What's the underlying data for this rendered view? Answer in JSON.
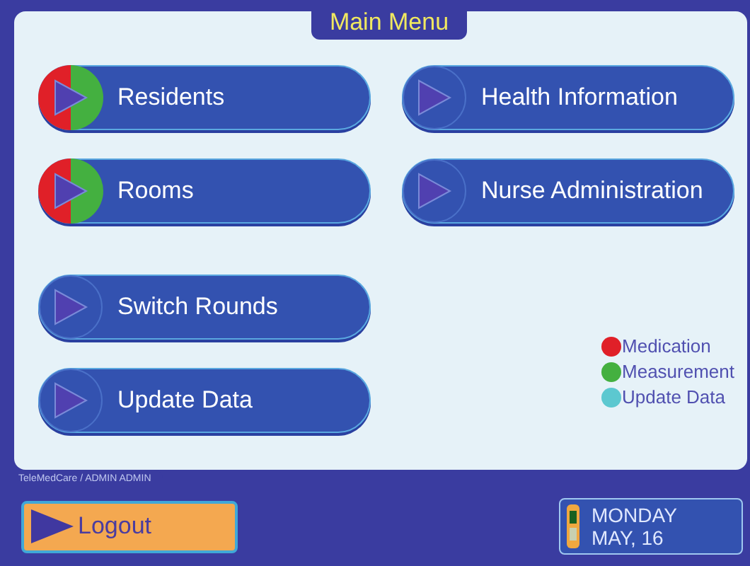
{
  "title": "Main Menu",
  "left_menu": [
    {
      "label": "Residents",
      "markers": [
        {
          "color": "#e02028"
        },
        {
          "color": "#44b040"
        }
      ]
    },
    {
      "label": "Rooms",
      "markers": [
        {
          "color": "#e02028"
        },
        {
          "color": "#44b040"
        }
      ]
    },
    {
      "label": "Switch Rounds"
    },
    {
      "label": "Update Data"
    }
  ],
  "right_menu": [
    {
      "label": "Health Information"
    },
    {
      "label": "Nurse Administration"
    }
  ],
  "legend": [
    {
      "label": "Medication",
      "color": "#e02028"
    },
    {
      "label": "Measurement",
      "color": "#44b040"
    },
    {
      "label": "Update Data",
      "color": "#5cc8d0"
    }
  ],
  "user_tab": "TeleMedCare / ADMIN ADMIN",
  "logout": "Logout",
  "date": {
    "day": "MONDAY",
    "date": "MAY, 16"
  }
}
